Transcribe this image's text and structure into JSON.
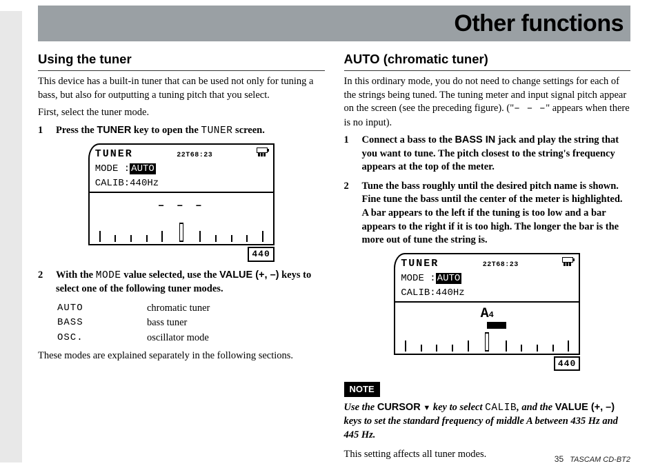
{
  "header": {
    "title": "Other functions"
  },
  "left": {
    "heading": "Using the tuner",
    "p1": "This device has a built-in tuner that can be used not only for tuning a bass, but also for outputting a tuning pitch that you select.",
    "p2": "First, select the tuner mode.",
    "step1": {
      "num": "1",
      "pre": "Press the ",
      "key": "TUNER",
      "mid": " key to open the ",
      "mono": "TUNER",
      "post": " screen."
    },
    "lcd": {
      "tuner": "TUNER",
      "time": "22T68:23",
      "mode_label": "MODE :",
      "mode_val": "AUTO",
      "calib": "CALIB:440Hz",
      "center_chars": "– – –",
      "ref": "440"
    },
    "step2": {
      "num": "2",
      "pre": "With the ",
      "mono": "MODE",
      "mid": " value selected, use the ",
      "key": "VALUE (+, –)",
      "post": " keys to select one of the following tuner modes."
    },
    "modes": [
      {
        "k": "AUTO",
        "v": "chromatic tuner"
      },
      {
        "k": "BASS",
        "v": "bass tuner"
      },
      {
        "k": "OSC.",
        "v": "oscillator mode"
      }
    ],
    "p3": "These modes are explained separately in the following sections."
  },
  "right": {
    "heading": "AUTO (chromatic tuner)",
    "p1a": "In this ordinary mode, you do not need to change settings for each of the strings being tuned. The tuning meter and input signal pitch appear on the screen (see the preceding figure). (\"",
    "p1mono": "– – –",
    "p1b": "\" appears when there is no input).",
    "step1": {
      "num": "1",
      "pre": "Connect a bass to the ",
      "key": "BASS IN",
      "post": " jack and play the string that you want to tune. The pitch closest to the string's frequency appears at the top of the meter."
    },
    "step2": {
      "num": "2",
      "body": "Tune the bass roughly until the desired pitch name is shown. Fine tune the bass until the center of the meter is highlighted. A bar appears to the left if the tuning is too low and a bar appears to the right if it is too high. The longer the bar is the more out of tune the string is."
    },
    "lcd": {
      "tuner": "TUNER",
      "time": "22T68:23",
      "mode_label": "MODE :",
      "mode_val": "AUTO",
      "calib": "CALIB:440Hz",
      "pitch": "A",
      "pitch_oct": "4",
      "ref": "440"
    },
    "note_label": "NOTE",
    "note": {
      "a": "Use the ",
      "key1": "CURSOR",
      "b": " key to select ",
      "mono": "CALIB",
      "c": ", and the ",
      "key2": "VALUE (+, –)",
      "d": " keys to set the standard frequency of middle A between 435 Hz and 445 Hz."
    },
    "p2": "This setting affects all tuner modes."
  },
  "footer": {
    "page": "35",
    "model": "TASCAM  CD-BT2"
  }
}
